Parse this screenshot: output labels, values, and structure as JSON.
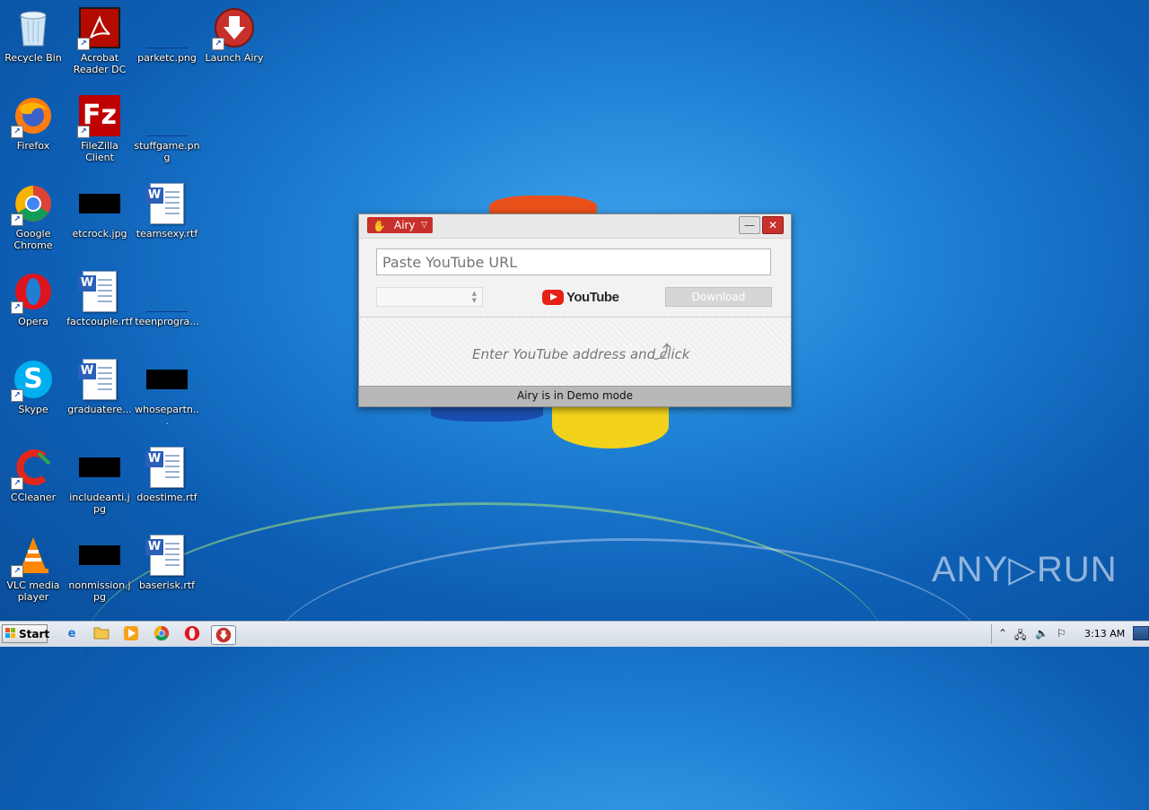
{
  "desktop": {
    "icons": [
      {
        "label": "Recycle Bin",
        "icon": "recycle-bin-icon"
      },
      {
        "label": "Acrobat Reader DC",
        "icon": "acrobat-icon"
      },
      {
        "label": "parketc.png",
        "icon": "image-file-icon"
      },
      {
        "label": "Launch Airy",
        "icon": "airy-icon"
      },
      {
        "label": "Firefox",
        "icon": "firefox-icon"
      },
      {
        "label": "FileZilla Client",
        "icon": "filezilla-icon"
      },
      {
        "label": "stuffgame.png",
        "icon": "image-file-icon"
      },
      {
        "label": "Google Chrome",
        "icon": "chrome-icon"
      },
      {
        "label": "etcrock.jpg",
        "icon": "image-file-icon"
      },
      {
        "label": "teamsexy.rtf",
        "icon": "word-doc-icon"
      },
      {
        "label": "Opera",
        "icon": "opera-icon"
      },
      {
        "label": "factcouple.rtf",
        "icon": "word-doc-icon"
      },
      {
        "label": "teenprogra...",
        "icon": "image-file-icon"
      },
      {
        "label": "Skype",
        "icon": "skype-icon"
      },
      {
        "label": "graduatere...",
        "icon": "word-doc-icon"
      },
      {
        "label": "whosepartn...",
        "icon": "image-file-icon"
      },
      {
        "label": "CCleaner",
        "icon": "ccleaner-icon"
      },
      {
        "label": "includeanti.jpg",
        "icon": "image-file-icon"
      },
      {
        "label": "doestime.rtf",
        "icon": "word-doc-icon"
      },
      {
        "label": "VLC media player",
        "icon": "vlc-icon"
      },
      {
        "label": "nonmission.jpg",
        "icon": "image-file-icon"
      },
      {
        "label": "baserisk.rtf",
        "icon": "word-doc-icon"
      }
    ]
  },
  "airy": {
    "menu_label": "Airy",
    "url_placeholder": "Paste YouTube URL",
    "youtube_logo_text": "YouTube",
    "download_label": "Download",
    "hint": "Enter YouTube address and click",
    "status": "Airy is in Demo mode",
    "minimize_glyph": "—",
    "close_glyph": "✕"
  },
  "taskbar": {
    "start_label": "Start",
    "clock": "3:13 AM",
    "apps": [
      {
        "name": "internet-explorer-icon"
      },
      {
        "name": "file-explorer-icon"
      },
      {
        "name": "media-player-icon"
      },
      {
        "name": "chrome-icon"
      },
      {
        "name": "opera-icon"
      },
      {
        "name": "airy-icon",
        "active": true
      }
    ]
  },
  "watermark": {
    "text": "ANY▷RUN"
  },
  "colors": {
    "airy_red": "#c7302b",
    "desktop_blue": "#1e7fd3",
    "youtube_red": "#e62117"
  }
}
